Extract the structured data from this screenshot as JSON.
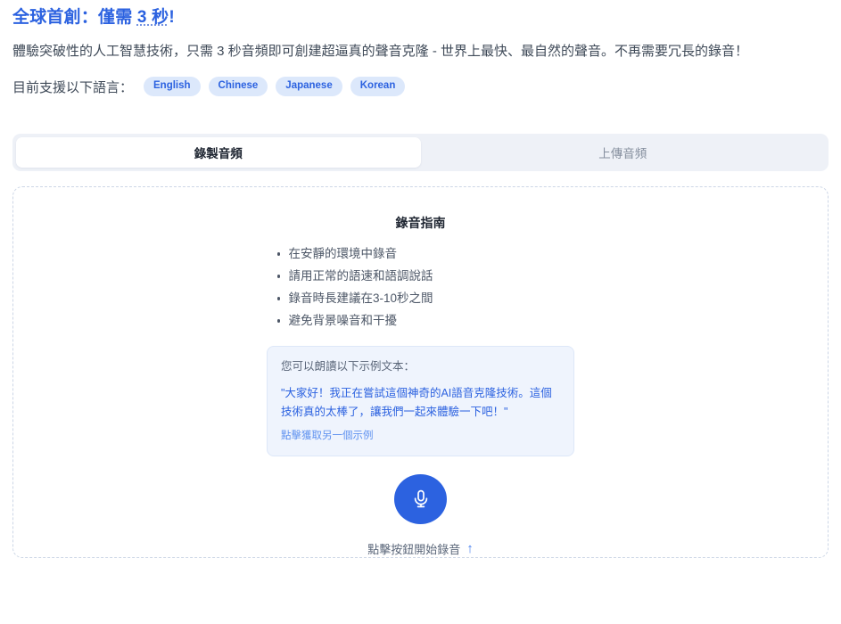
{
  "hero": {
    "title_prefix": "全球首創：僅需 ",
    "title_highlight": "3 秒",
    "title_suffix": "!",
    "description": "體驗突破性的人工智慧技術，只需 3 秒音頻即可創建超逼真的聲音克隆 - 世界上最快、最自然的聲音。不再需要冗長的錄音！",
    "languages_label": "目前支援以下語言：",
    "languages": [
      "English",
      "Chinese",
      "Japanese",
      "Korean"
    ]
  },
  "tabs": [
    {
      "label": "錄製音頻",
      "active": true
    },
    {
      "label": "上傳音頻",
      "active": false
    }
  ],
  "recorder": {
    "guide_title": "錄音指南",
    "guide_items": [
      "在安靜的環境中錄音",
      "請用正常的語速和語調說話",
      "錄音時長建議在3-10秒之間",
      "避免背景噪音和干擾"
    ],
    "example": {
      "prompt": "您可以朗讀以下示例文本：",
      "quote": "\"大家好！我正在嘗試這個神奇的AI語音克隆技術。這個技術真的太棒了，讓我們一起來體驗一下吧！\"",
      "link": "點擊獲取另一個示例"
    },
    "mic_icon": "microphone-icon",
    "hint_text": "點擊按鈕開始錄音",
    "hint_arrow": "↑"
  },
  "colors": {
    "accent": "#2c62e0",
    "pill_bg": "#dce8fb",
    "tab_bar_bg": "#eef1f7",
    "example_bg": "#eff4fd",
    "panel_border": "#ccd6e6"
  }
}
